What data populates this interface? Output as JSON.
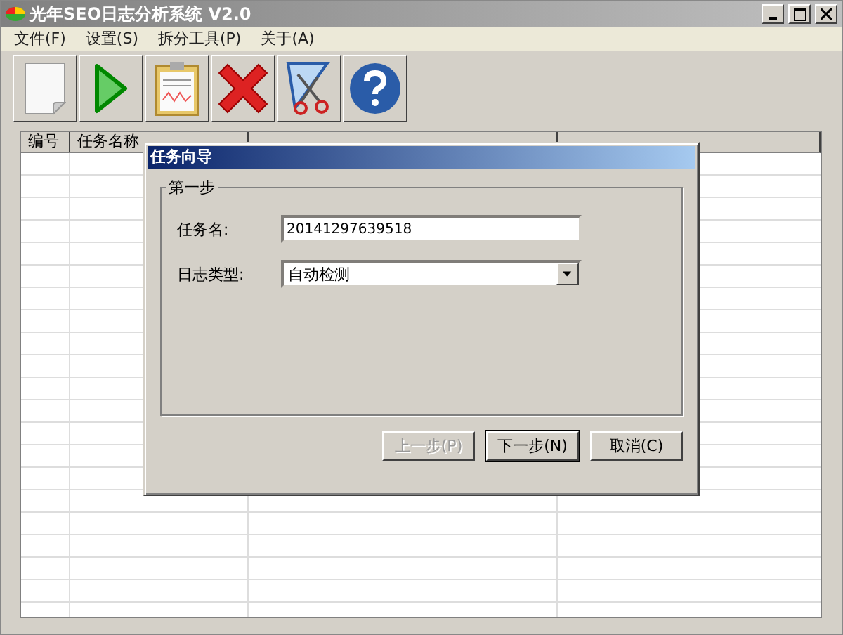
{
  "window": {
    "title": "光年SEO日志分析系统 V2.0",
    "active": false
  },
  "menu": [
    "文件(F)",
    "设置(S)",
    "拆分工具(P)",
    "关于(A)"
  ],
  "toolbar": [
    {
      "kind": "new"
    },
    {
      "kind": "start"
    },
    {
      "kind": "report"
    },
    {
      "kind": "delete"
    },
    {
      "kind": "split"
    },
    {
      "kind": "help"
    }
  ],
  "table": {
    "columns": [
      {
        "label": "编号"
      },
      {
        "label": "任务名称"
      },
      {},
      {}
    ]
  },
  "dialog": {
    "title": "任务向导",
    "group": "第一步",
    "fields": [
      {
        "kind": "text",
        "label": "任务名:",
        "value": "20141297639518"
      },
      {
        "kind": "select",
        "label": "日志类型:",
        "value": "自动检测"
      }
    ],
    "buttons": [
      {
        "label": "上一步(P)",
        "disabled": true,
        "default": false
      },
      {
        "label": "下一步(N)",
        "disabled": false,
        "default": true
      },
      {
        "label": "取消(C)",
        "disabled": false,
        "default": false
      }
    ]
  }
}
